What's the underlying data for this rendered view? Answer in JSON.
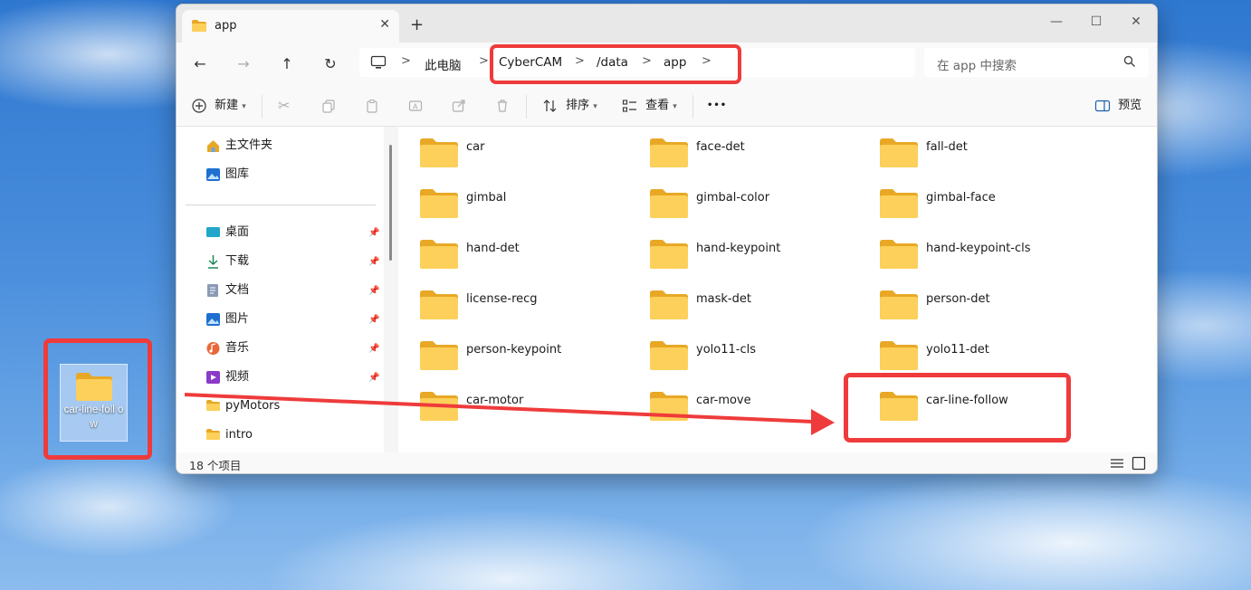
{
  "desktop": {
    "icon_label": "car-line-foll ow"
  },
  "window": {
    "tab_title": "app",
    "tab_close": "✕",
    "new_tab": "+",
    "controls": {
      "minimize": "—",
      "maximize": "☐",
      "close": "✕"
    }
  },
  "nav": {
    "back": "←",
    "forward": "→",
    "up": "↑",
    "refresh": "↻"
  },
  "address": {
    "crumbs": [
      "此电脑",
      "CyberCAM",
      "/data",
      "app"
    ],
    "separator": ">"
  },
  "search": {
    "placeholder": "在 app 中搜索"
  },
  "toolbar": {
    "new_label": "新建",
    "sort_label": "排序",
    "view_label": "查看",
    "more_label": "•••",
    "preview_label": "预览"
  },
  "sidebar": {
    "quick": [
      {
        "label": "主文件夹",
        "icon": "home-icon"
      },
      {
        "label": "图库",
        "icon": "gallery-icon"
      }
    ],
    "pinned": [
      {
        "label": "桌面",
        "icon": "desktop-icon"
      },
      {
        "label": "下载",
        "icon": "download-icon"
      },
      {
        "label": "文档",
        "icon": "document-icon"
      },
      {
        "label": "图片",
        "icon": "pictures-icon"
      },
      {
        "label": "音乐",
        "icon": "music-icon"
      },
      {
        "label": "视频",
        "icon": "video-icon"
      }
    ],
    "folders": [
      {
        "label": "pyMotors",
        "icon": "folder-icon"
      },
      {
        "label": "intro",
        "icon": "folder-icon"
      }
    ]
  },
  "files": [
    "car",
    "face-det",
    "fall-det",
    "gimbal",
    "gimbal-color",
    "gimbal-face",
    "hand-det",
    "hand-keypoint",
    "hand-keypoint-cls",
    "license-recg",
    "mask-det",
    "person-det",
    "person-keypoint",
    "yolo11-cls",
    "yolo11-det",
    "car-motor",
    "car-move",
    "car-line-follow"
  ],
  "status": {
    "count": "18 个项目"
  },
  "colors": {
    "annotation_red": "#ef3b3b",
    "folder_yellow": "#f8c93f"
  }
}
